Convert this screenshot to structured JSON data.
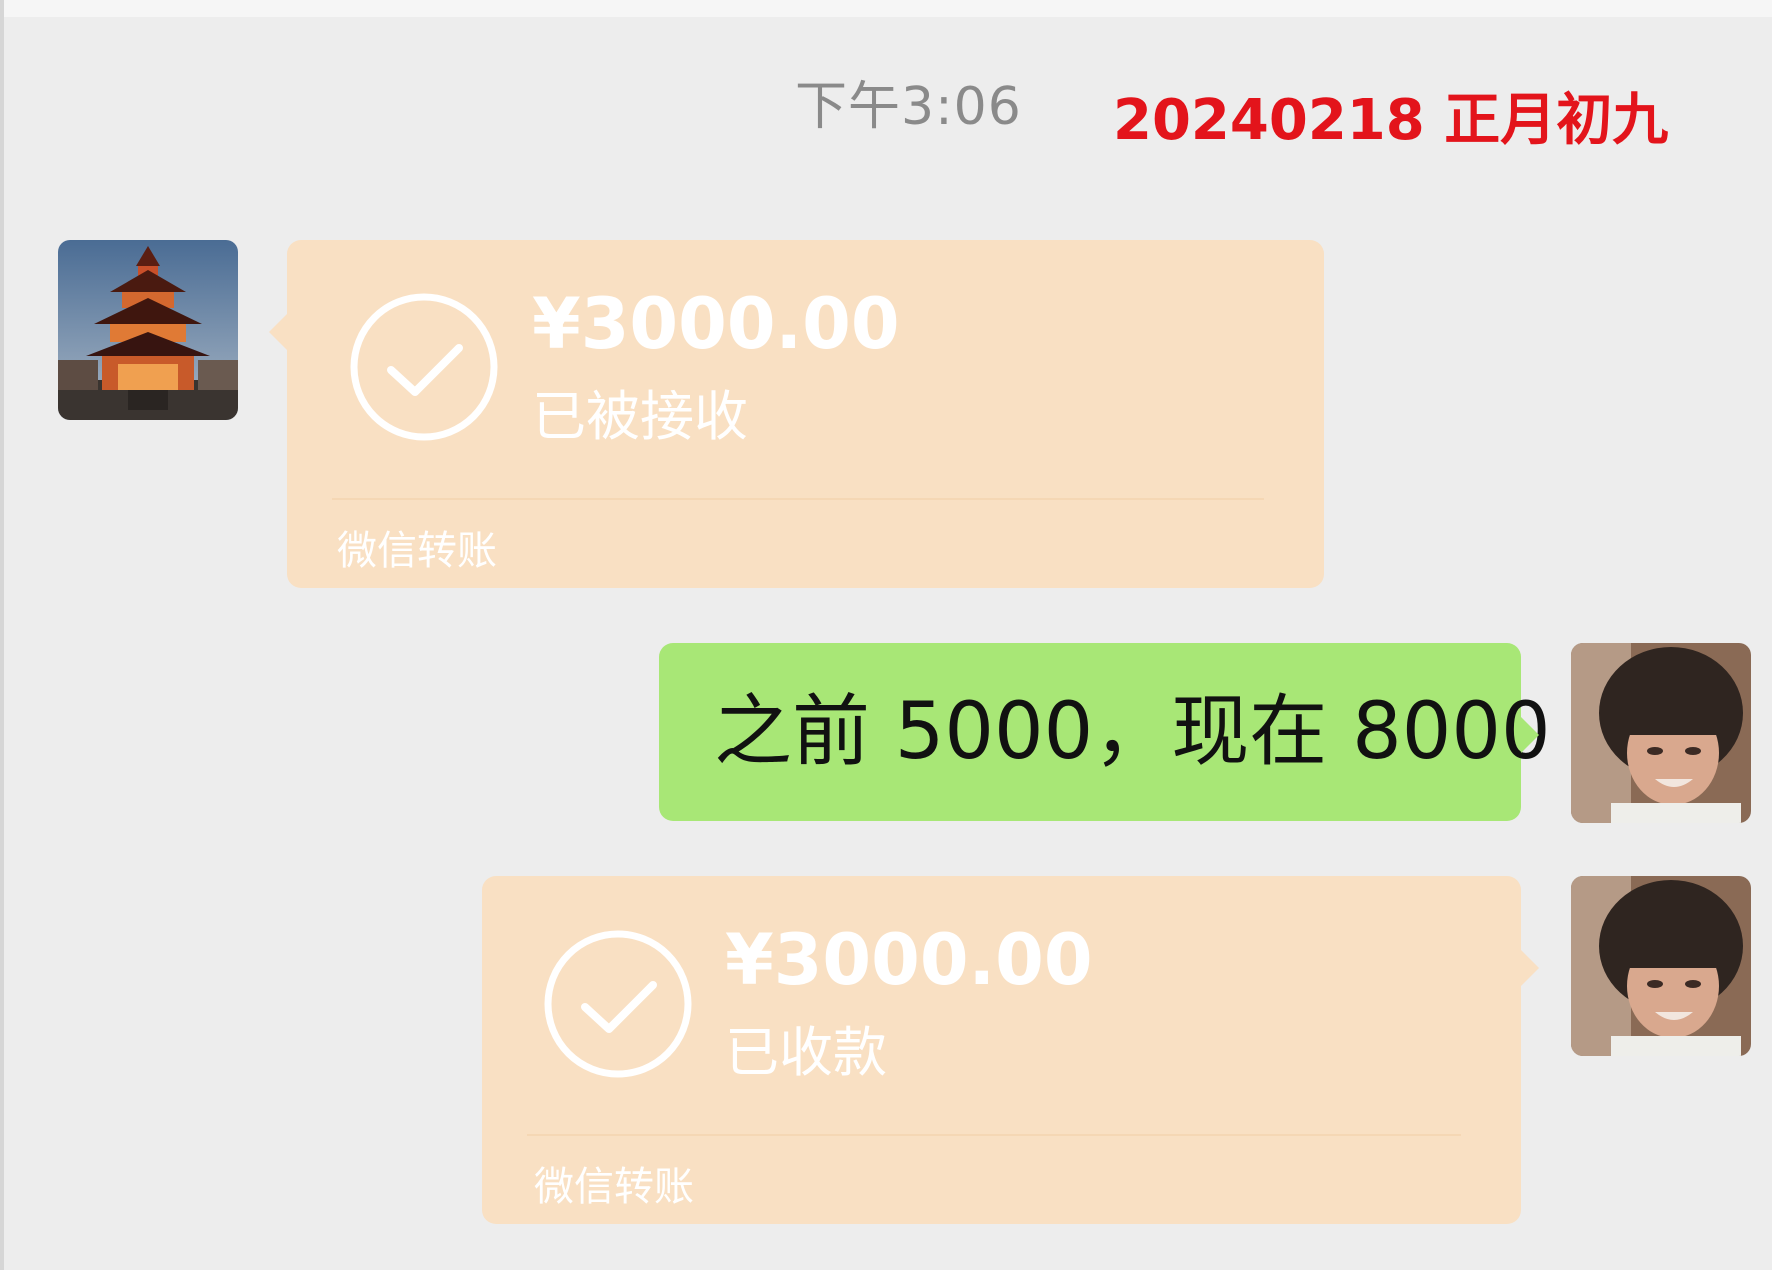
{
  "header": {
    "time": "下午3:06",
    "date_note": "20240218 正月初九"
  },
  "messages": [
    {
      "type": "transfer",
      "side": "left",
      "amount": "¥3000.00",
      "status": "已被接收",
      "footer": "微信转账",
      "avatar_icon": "pagoda-avatar"
    },
    {
      "type": "text",
      "side": "right",
      "text": "之前 5000，现在 8000",
      "avatar_icon": "girl-portrait-avatar"
    },
    {
      "type": "transfer",
      "side": "right",
      "amount": "¥3000.00",
      "status": "已收款",
      "footer": "微信转账",
      "avatar_icon": "girl-portrait-avatar"
    }
  ],
  "colors": {
    "transfer_bubble": "#f9e0c3",
    "text_bubble": "#a8e776",
    "date_note": "#e3141b",
    "background": "#ededed"
  }
}
